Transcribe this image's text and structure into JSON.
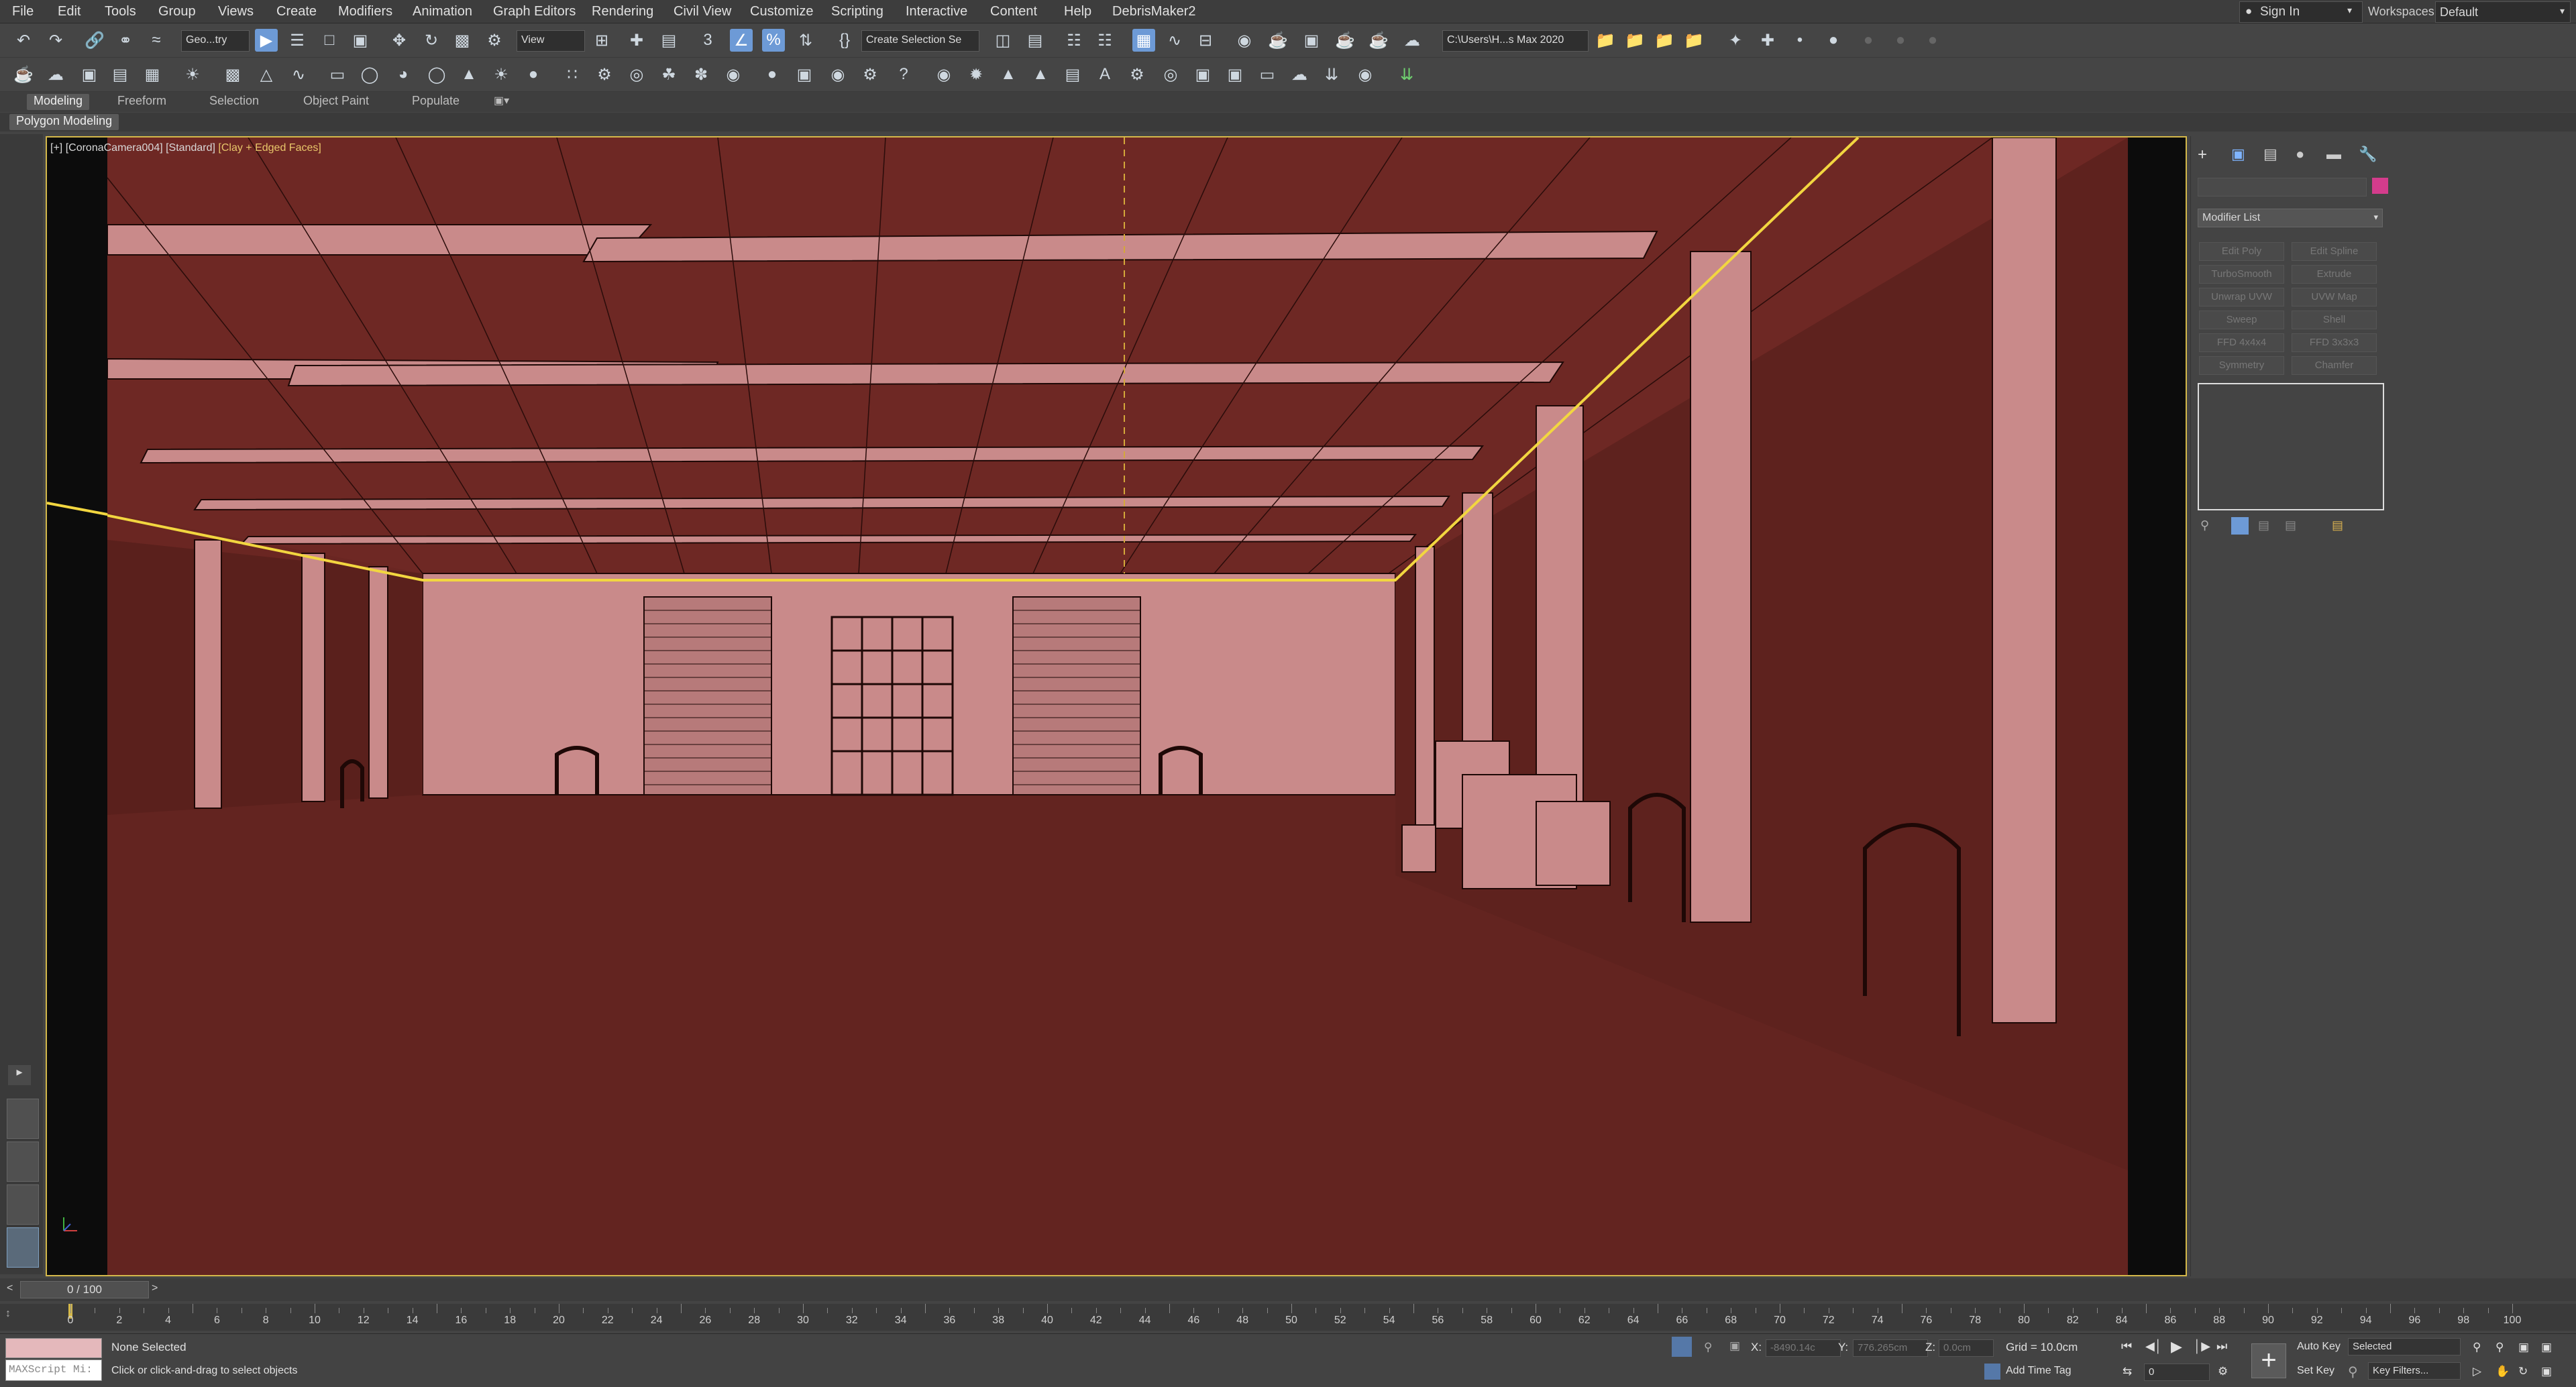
{
  "menu": [
    "File",
    "Edit",
    "Tools",
    "Group",
    "Views",
    "Create",
    "Modifiers",
    "Animation",
    "Graph Editors",
    "Rendering",
    "Civil View",
    "Customize",
    "Scripting",
    "Interactive",
    "Content",
    "Help",
    "DebrisMaker2"
  ],
  "account": {
    "sign_in": "Sign In",
    "workspaces_label": "Workspaces:",
    "workspace": "Default"
  },
  "toolbar": {
    "selection_filter": "Geo...try",
    "reference_coord": "View",
    "named_selection": "Create Selection Se",
    "project_path": "C:\\Users\\H...s Max 2020"
  },
  "ribbon": {
    "tabs": [
      "Modeling",
      "Freeform",
      "Selection",
      "Object Paint",
      "Populate"
    ],
    "sub": "Polygon Modeling"
  },
  "viewport": {
    "label_plus": "[+]",
    "label_camera": "[CoronaCamera004]",
    "label_mode": "[Standard]",
    "label_shading": "[Clay + Edged Faces]"
  },
  "command_panel": {
    "modifier_list": "Modifier List",
    "buttons": [
      "Edit Poly",
      "Edit Spline",
      "TurboSmooth",
      "Extrude",
      "Unwrap UVW",
      "UVW Map",
      "Sweep",
      "Shell",
      "FFD 4x4x4",
      "FFD 3x3x3",
      "Symmetry",
      "Chamfer"
    ]
  },
  "timeline": {
    "frame": "0 / 100",
    "ticks": [
      "0",
      "2",
      "4",
      "6",
      "8",
      "10",
      "12",
      "14",
      "16",
      "18",
      "20",
      "22",
      "24",
      "26",
      "28",
      "30",
      "32",
      "34",
      "36",
      "38",
      "40",
      "42",
      "44",
      "46",
      "48",
      "50",
      "52",
      "54",
      "56",
      "58",
      "60",
      "62",
      "64",
      "66",
      "68",
      "70",
      "72",
      "74",
      "76",
      "78",
      "80",
      "82",
      "84",
      "86",
      "88",
      "90",
      "92",
      "94",
      "96",
      "98",
      "100"
    ]
  },
  "status": {
    "maxscript": "MAXScript Mi:",
    "selection": "None Selected",
    "prompt": "Click or click-and-drag to select objects",
    "x_label": "X:",
    "x_value": "-8490.14c",
    "y_label": "Y:",
    "y_value": "776.265cm",
    "z_label": "Z:",
    "z_value": "0.0cm",
    "grid": "Grid = 10.0cm",
    "add_time_tag": "Add Time Tag",
    "auto_key": "Auto Key",
    "set_key": "Set Key",
    "key_mode": "Selected",
    "key_filters": "Key Filters...",
    "frame_field": "0"
  }
}
